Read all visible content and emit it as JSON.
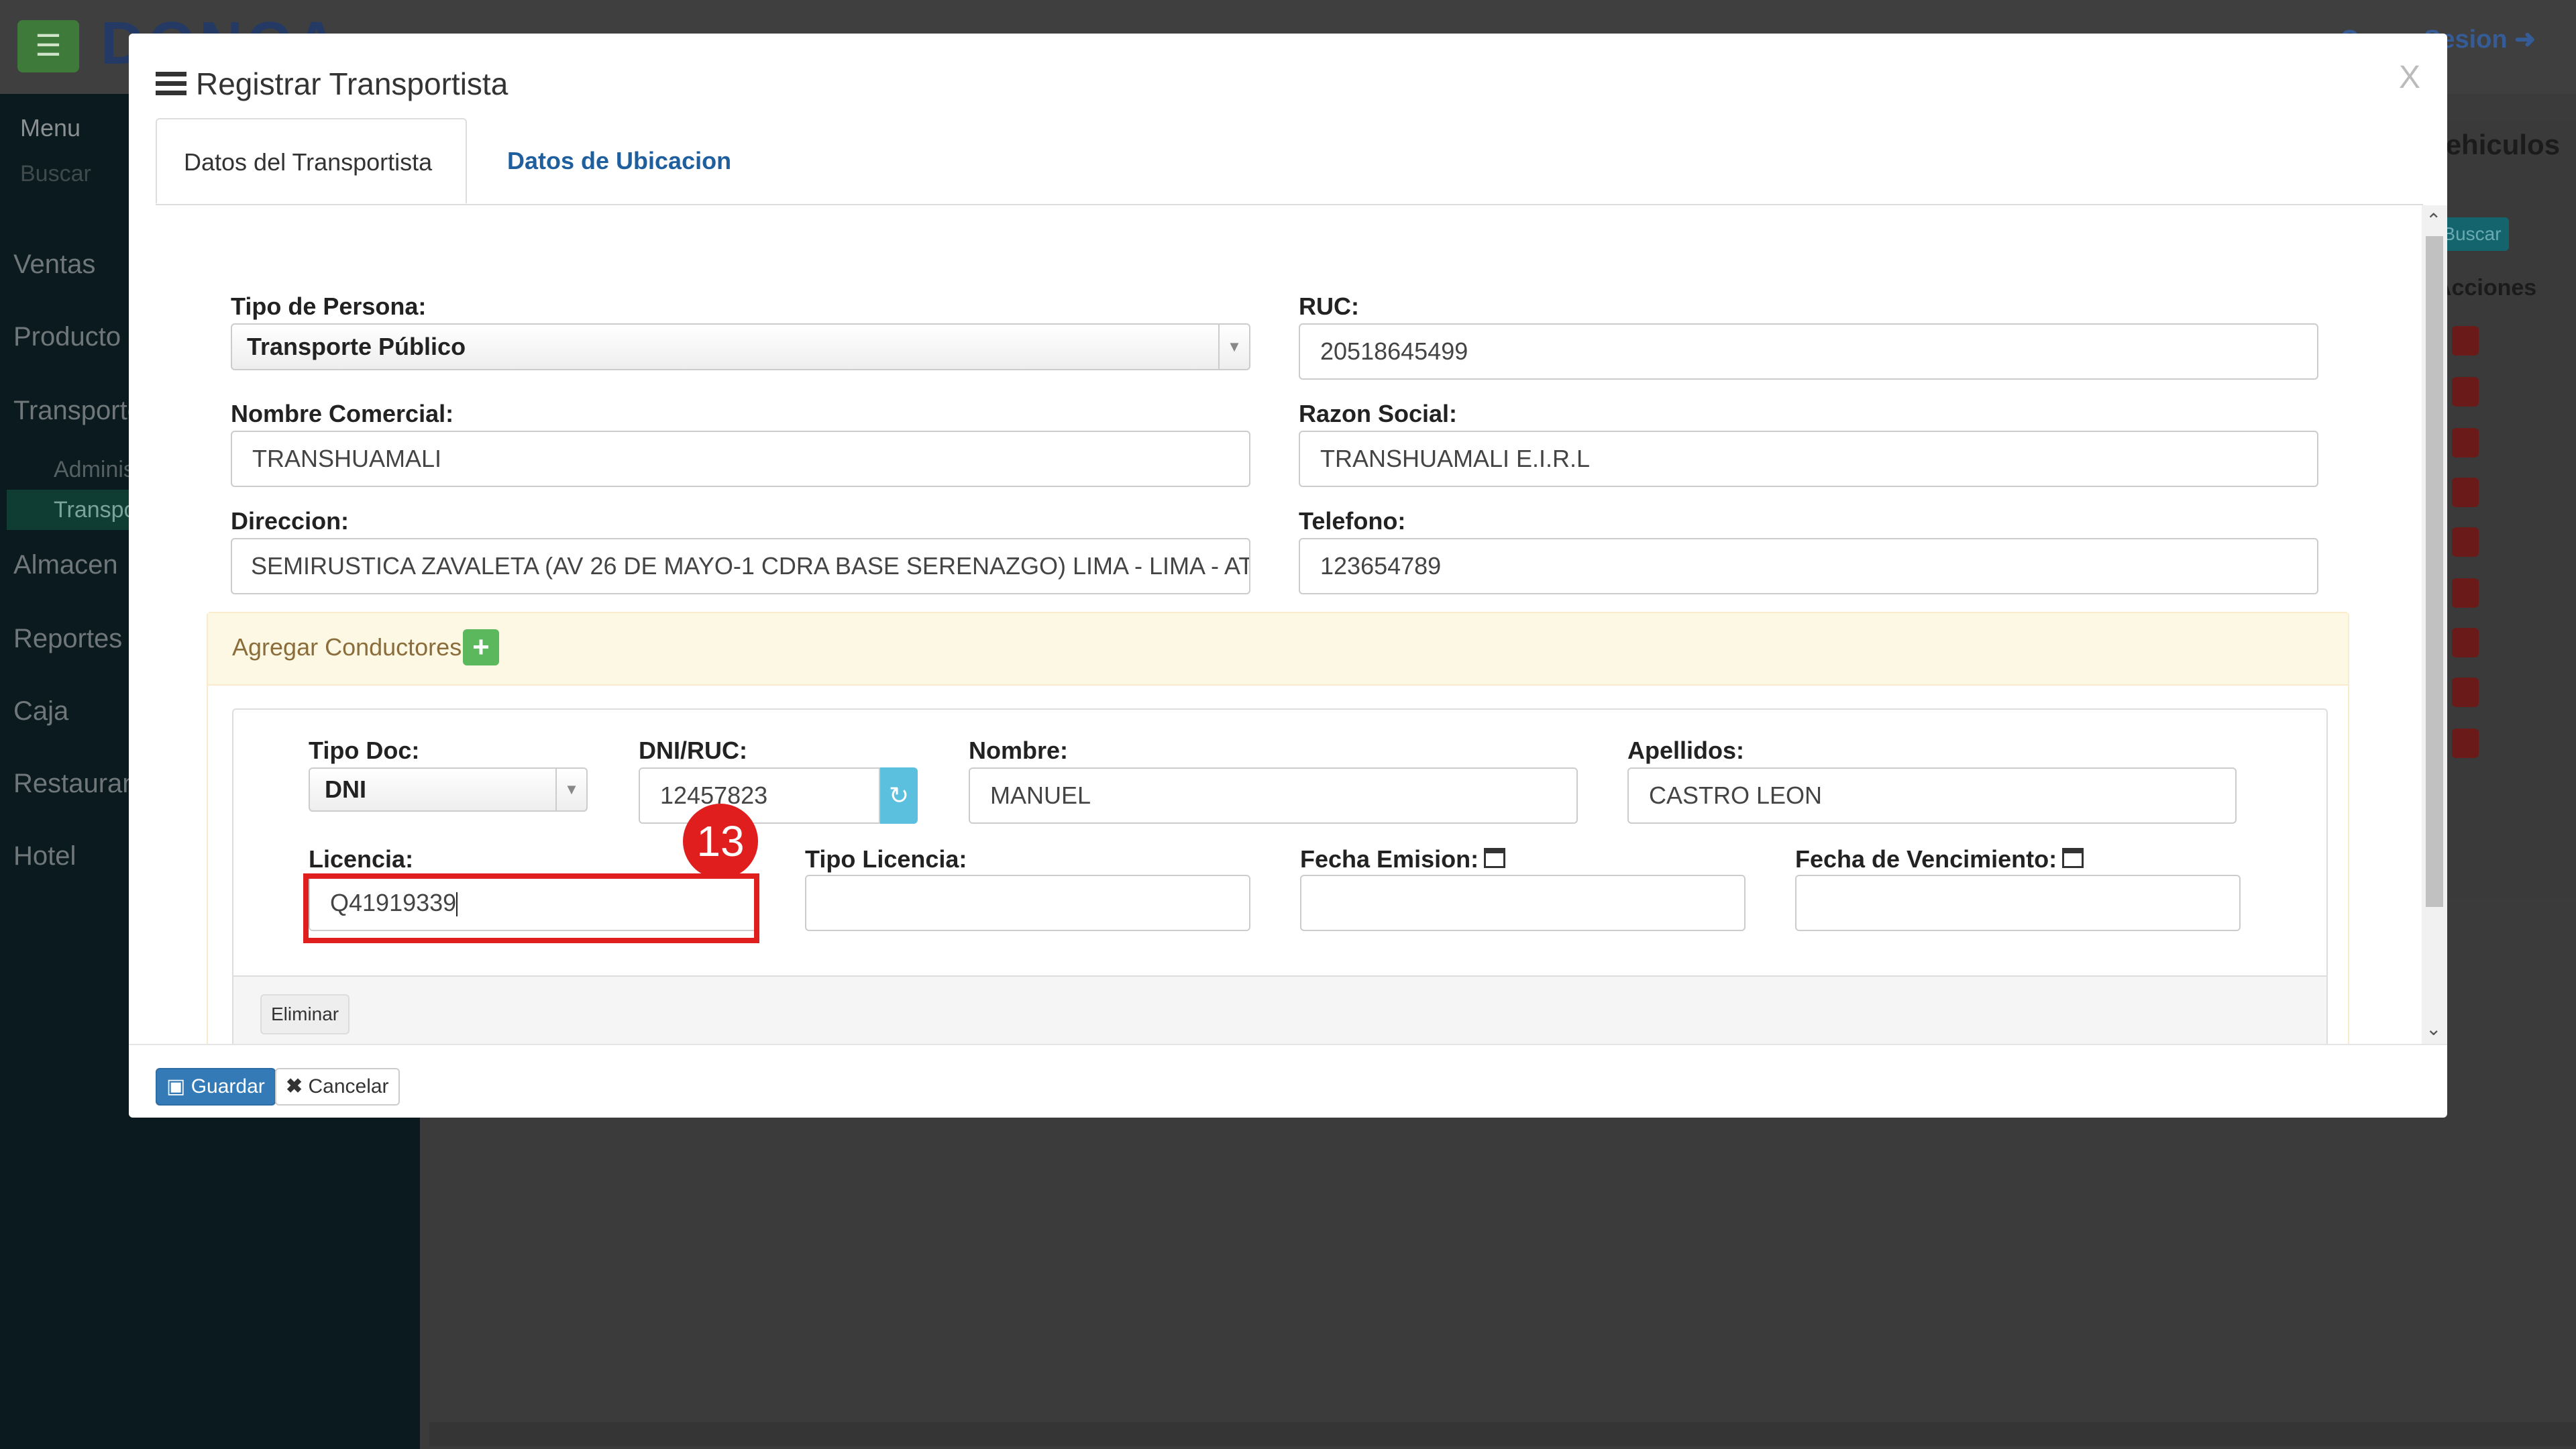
{
  "background": {
    "logo_text": "DONCA",
    "logout_label": "Cerrar Sesion",
    "sidebar": {
      "title": "Menu",
      "search_placeholder": "Buscar",
      "items": [
        "Ventas",
        "Producto",
        "Transporte",
        "Almacen",
        "Reportes",
        "Caja",
        "Restaurant",
        "Hotel"
      ],
      "sub_items": [
        "Administrar",
        "Transportista"
      ]
    },
    "right_panel": {
      "title": "Vehiculos",
      "search_button": "Buscar",
      "column_header": "Acciones"
    }
  },
  "modal": {
    "title": "Registrar Transportista",
    "close_label": "X",
    "tabs": [
      {
        "label": "Datos del Transportista",
        "active": true
      },
      {
        "label": "Datos de Ubicacion",
        "active": false
      }
    ],
    "form": {
      "tipo_persona": {
        "label": "Tipo de Persona:",
        "value": "Transporte Público"
      },
      "ruc": {
        "label": "RUC:",
        "value": "20518645499"
      },
      "nombre_comercial": {
        "label": "Nombre Comercial:",
        "value": "TRANSHUAMALI"
      },
      "razon_social": {
        "label": "Razon Social:",
        "value": "TRANSHUAMALI E.I.R.L"
      },
      "direccion": {
        "label": "Direccion:",
        "value": "SEMIRUSTICA ZAVALETA (AV 26 DE MAYO-1 CDRA BASE SERENAZGO) LIMA - LIMA - AT"
      },
      "telefono": {
        "label": "Telefono:",
        "value": "123654789"
      }
    },
    "conductores": {
      "panel_title": "Agregar Conductores",
      "add_icon": "plus-icon",
      "driver": {
        "tipo_doc": {
          "label": "Tipo Doc:",
          "value": "DNI"
        },
        "dni_ruc": {
          "label": "DNI/RUC:",
          "value": "12457823"
        },
        "nombre": {
          "label": "Nombre:",
          "value": "MANUEL"
        },
        "apellidos": {
          "label": "Apellidos:",
          "value": "CASTRO LEON"
        },
        "licencia": {
          "label": "Licencia:",
          "value": "Q41919339"
        },
        "tipo_licencia": {
          "label": "Tipo Licencia:",
          "value": ""
        },
        "fecha_emision": {
          "label": "Fecha Emision:",
          "value": ""
        },
        "fecha_vencimiento": {
          "label": "Fecha de Vencimiento:",
          "value": ""
        },
        "delete_label": "Eliminar"
      }
    },
    "footer": {
      "save_label": "Guardar",
      "cancel_label": "Cancelar"
    },
    "annotation": {
      "step_number": "13",
      "color": "#e01e1e"
    }
  },
  "colors": {
    "primary": "#337ab7",
    "success": "#5cb85c",
    "info": "#5bc0de",
    "warning_bg": "#fcf8e3",
    "link": "#1f5f9e"
  }
}
